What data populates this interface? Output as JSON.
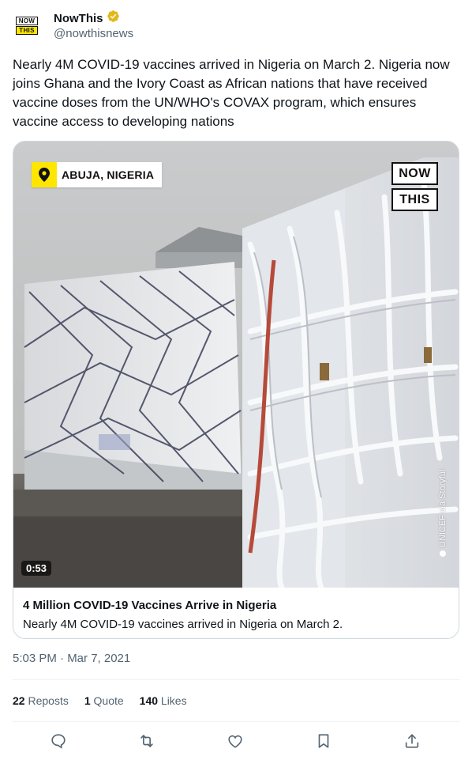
{
  "author": {
    "display_name": "NowThis",
    "handle": "@nowthisnews",
    "logo_top": "NOW",
    "logo_bottom": "THIS",
    "verified_color": "#e2b719"
  },
  "tweet": {
    "text": "Nearly 4M COVID-19 vaccines arrived in Nigeria on March 2. Nigeria now joins Ghana and the Ivory Coast as African nations that have received vaccine doses from the UN/WHO's COVAX program, which ensures vaccine access to developing nations",
    "timestamp": "5:03 PM · Mar 7, 2021"
  },
  "media": {
    "location": "ABUJA, NIGERIA",
    "overlay_logo_top": "NOW",
    "overlay_logo_bottom": "THIS",
    "credit": "UNICEF via Storyful",
    "duration": "0:53",
    "card_title": "4 Million COVID-19 Vaccines Arrive in Nigeria",
    "card_description": "Nearly 4M COVID-19 vaccines arrived in Nigeria on March 2."
  },
  "stats": {
    "reposts_count": "22",
    "reposts_label": "Reposts",
    "quotes_count": "1",
    "quotes_label": "Quote",
    "likes_count": "140",
    "likes_label": "Likes"
  },
  "actions": [
    "reply-icon",
    "repost-icon",
    "like-icon",
    "bookmark-icon",
    "share-icon"
  ],
  "colors": {
    "text": "#0f1419",
    "secondary": "#536471",
    "brand_yellow": "#ffe600",
    "action_blue": "#1d9bf0"
  }
}
